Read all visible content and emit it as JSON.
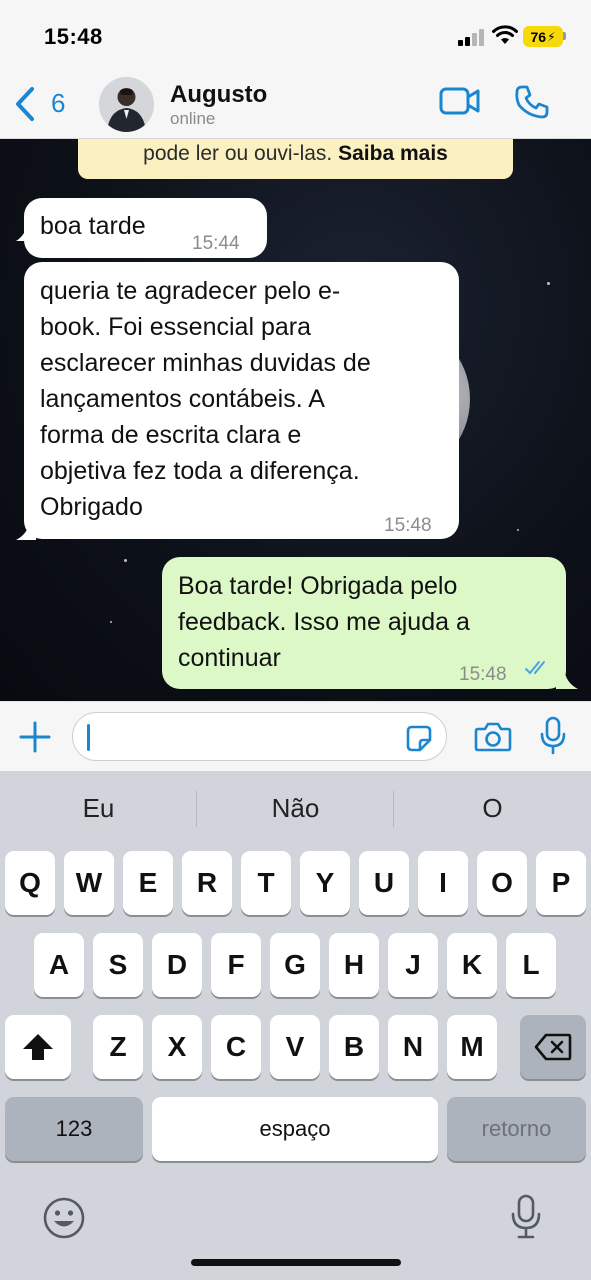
{
  "status_bar": {
    "time": "15:48",
    "battery": "76"
  },
  "header": {
    "back_count": "6",
    "contact_name": "Augusto",
    "contact_status": "online"
  },
  "notice": {
    "text": "pode ler ou ouvi-las.",
    "link": "Saiba mais"
  },
  "messages": [
    {
      "direction": "in",
      "lines": [
        "boa tarde"
      ],
      "time": "15:44"
    },
    {
      "direction": "in",
      "lines": [
        "queria te agradecer pelo e-",
        "book. Foi essencial para",
        "esclarecer minhas duvidas de",
        "lançamentos contábeis. A",
        "forma de escrita clara e",
        "objetiva fez toda a diferença.",
        "Obrigado"
      ],
      "time": "15:48"
    },
    {
      "direction": "out",
      "lines": [
        "Boa tarde! Obrigada pelo",
        "feedback. Isso me ajuda a",
        "continuar"
      ],
      "time": "15:48",
      "read": true
    }
  ],
  "composer": {
    "value": "",
    "placeholder": ""
  },
  "keyboard": {
    "suggestions": [
      "Eu",
      "Não",
      "O"
    ],
    "row1": [
      "Q",
      "W",
      "E",
      "R",
      "T",
      "Y",
      "U",
      "I",
      "O",
      "P"
    ],
    "row2": [
      "A",
      "S",
      "D",
      "F",
      "G",
      "H",
      "J",
      "K",
      "L"
    ],
    "row3": [
      "Z",
      "X",
      "C",
      "V",
      "B",
      "N",
      "M"
    ],
    "numbers_label": "123",
    "space_label": "espaço",
    "return_label": "retorno"
  },
  "colors": {
    "accent": "#1a86cf",
    "outgoing_bubble": "#dcf8c6",
    "incoming_bubble": "#ffffff",
    "notice_bg": "#fbf0c0",
    "battery": "#f5d90a"
  },
  "icons": [
    "back-chevron-icon",
    "video-call-icon",
    "phone-call-icon",
    "plus-icon",
    "sticker-icon",
    "camera-icon",
    "microphone-icon",
    "shift-icon",
    "backspace-icon",
    "emoji-icon",
    "read-receipt-icon"
  ]
}
